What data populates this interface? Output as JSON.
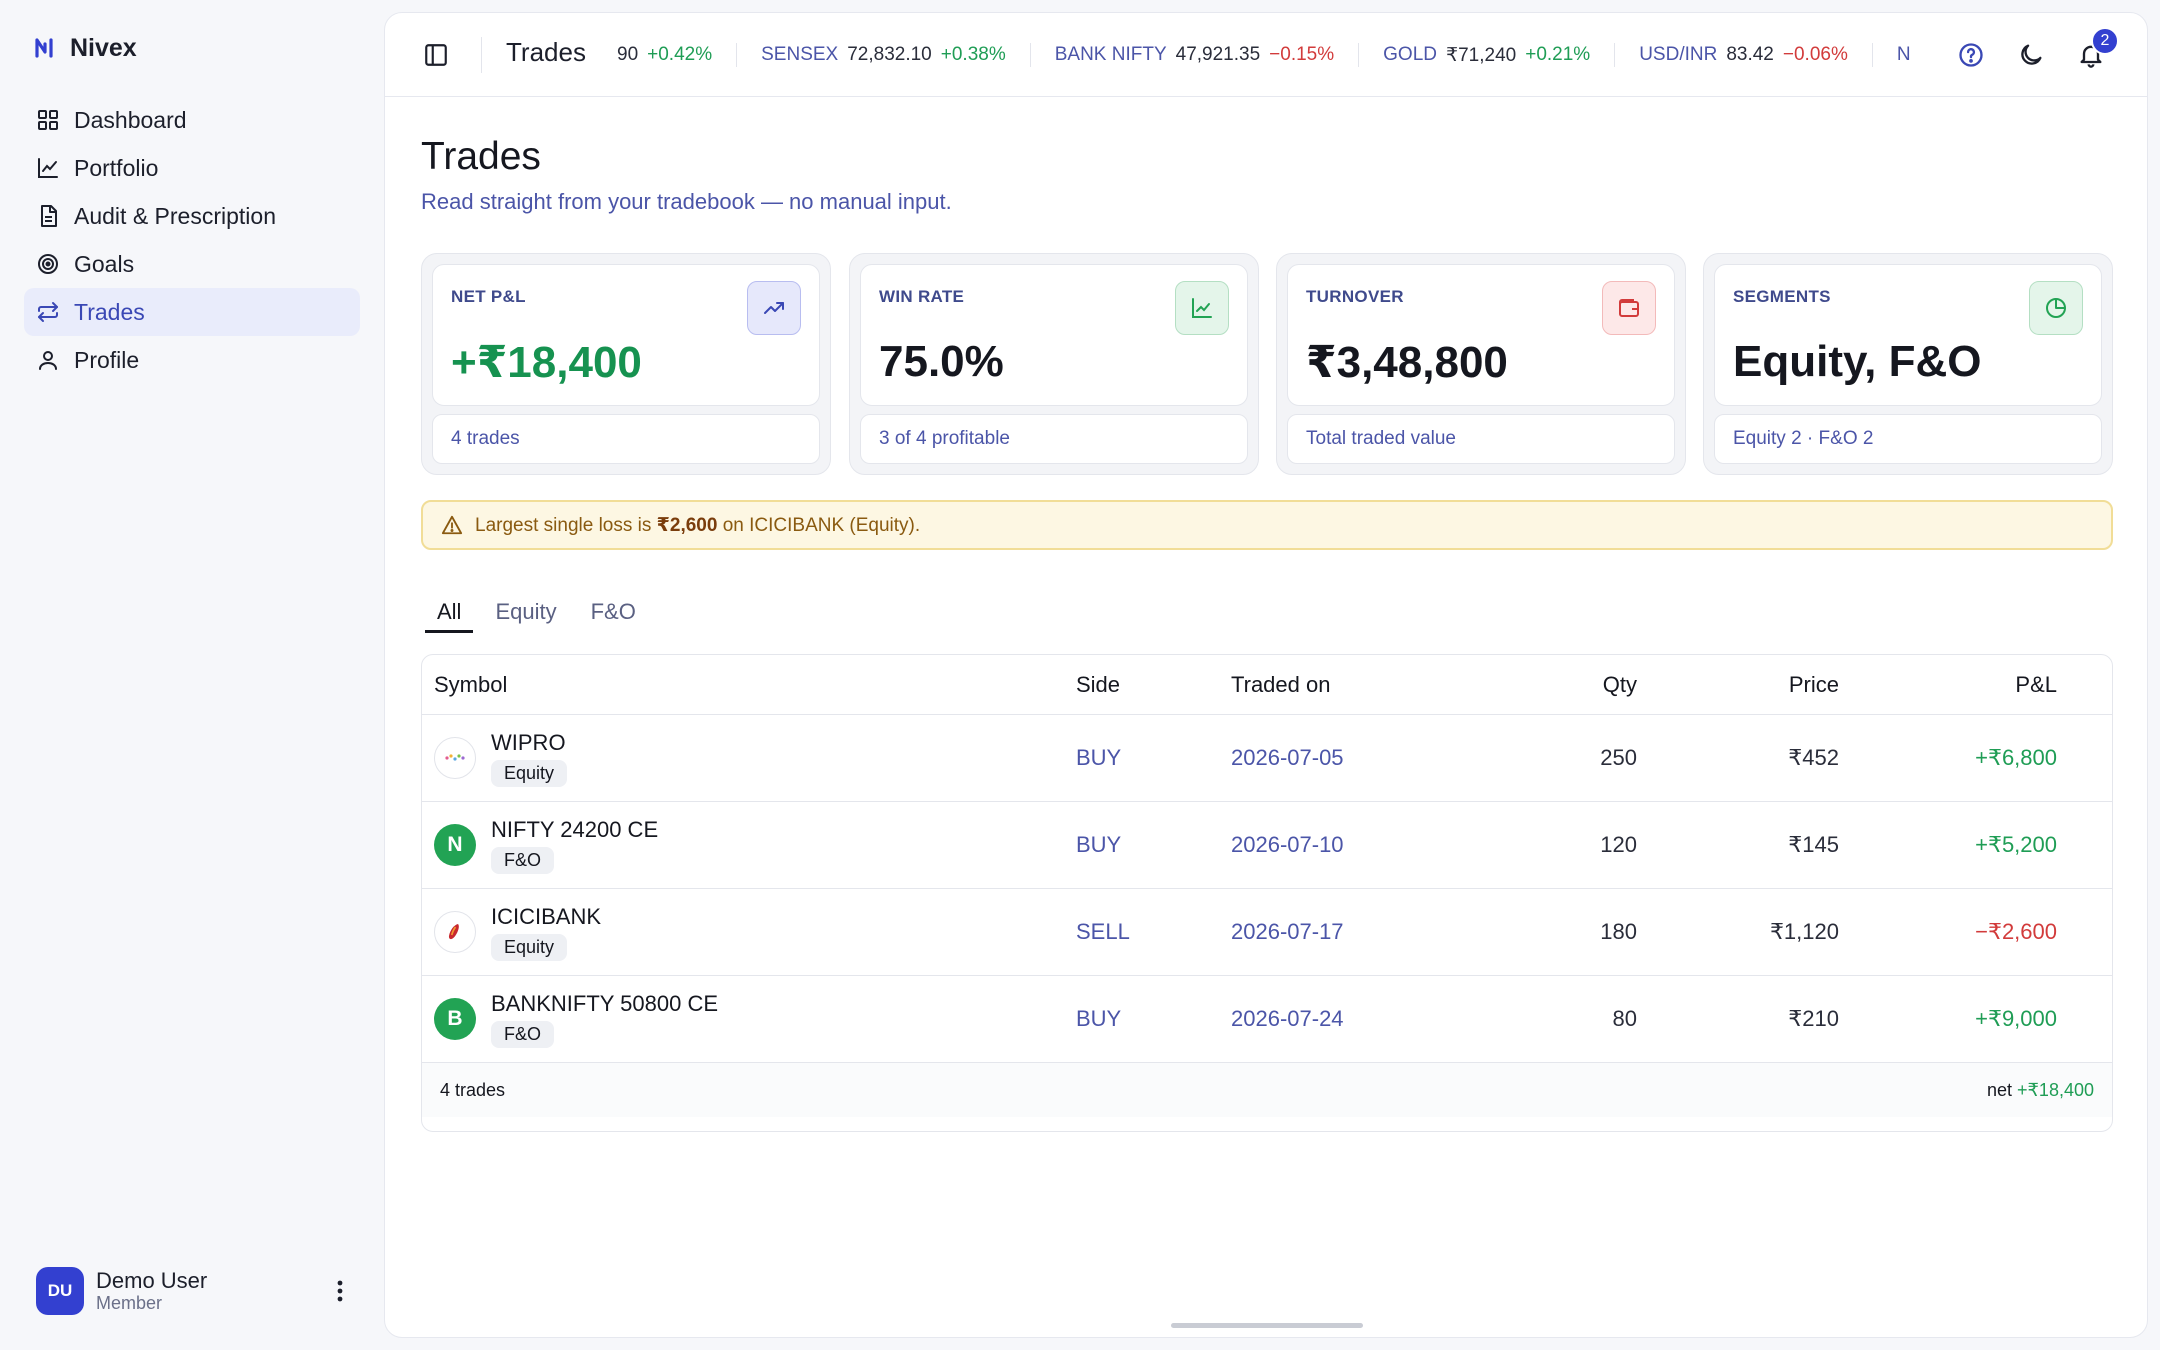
{
  "brand": {
    "name": "Nivex"
  },
  "nav": [
    {
      "label": "Dashboard",
      "icon": "dashboard-icon",
      "active": false
    },
    {
      "label": "Portfolio",
      "icon": "line-chart-icon",
      "active": false
    },
    {
      "label": "Audit & Prescription",
      "icon": "document-icon",
      "active": false
    },
    {
      "label": "Goals",
      "icon": "target-icon",
      "active": false
    },
    {
      "label": "Trades",
      "icon": "swap-icon",
      "active": true
    },
    {
      "label": "Profile",
      "icon": "user-icon",
      "active": false
    }
  ],
  "user": {
    "initials": "DU",
    "name": "Demo User",
    "role": "Member"
  },
  "topbar": {
    "title": "Trades",
    "notifications": "2",
    "ticker": [
      {
        "name": "",
        "value": "90",
        "change": "+0.42%",
        "dir": "pos"
      },
      {
        "name": "SENSEX",
        "value": "72,832.10",
        "change": "+0.38%",
        "dir": "pos"
      },
      {
        "name": "BANK NIFTY",
        "value": "47,921.35",
        "change": "−0.15%",
        "dir": "neg"
      },
      {
        "name": "GOLD",
        "value": "₹71,240",
        "change": "+0.21%",
        "dir": "pos"
      },
      {
        "name": "USD/INR",
        "value": "83.42",
        "change": "−0.06%",
        "dir": "neg"
      },
      {
        "name": "N",
        "value": "",
        "change": "",
        "dir": "pos"
      }
    ]
  },
  "page": {
    "title": "Trades",
    "subtitle": "Read straight from your tradebook — no manual input."
  },
  "stats": [
    {
      "label": "NET P&L",
      "value": "+₹18,400",
      "foot": "4 trades",
      "icon": "trend-up-icon",
      "tone": "blue",
      "green": true
    },
    {
      "label": "WIN RATE",
      "value": "75.0%",
      "foot": "3 of 4 profitable",
      "icon": "bar-chart-icon",
      "tone": "green",
      "green": false
    },
    {
      "label": "TURNOVER",
      "value": "₹3,48,800",
      "foot": "Total traded value",
      "icon": "wallet-icon",
      "tone": "red",
      "green": false
    },
    {
      "label": "SEGMENTS",
      "value": "Equity, F&O",
      "foot": "Equity 2 · F&O 2",
      "icon": "pie-chart-icon",
      "tone": "green",
      "green": false
    }
  ],
  "alert": {
    "prefix": "Largest single loss is ",
    "amount": "₹2,600",
    "suffix": " on ICICIBANK (Equity)."
  },
  "tabs": [
    {
      "label": "All",
      "active": true
    },
    {
      "label": "Equity",
      "active": false
    },
    {
      "label": "F&O",
      "active": false
    }
  ],
  "table": {
    "headers": {
      "symbol": "Symbol",
      "side": "Side",
      "date": "Traded on",
      "qty": "Qty",
      "price": "Price",
      "pl": "P&L"
    },
    "rows": [
      {
        "symbol": "WIPRO",
        "segment": "Equity",
        "logo": "wipro-logo",
        "initial": "",
        "side": "BUY",
        "date": "2026-07-05",
        "qty": "250",
        "price": "₹452",
        "pl": "+₹6,800",
        "dir": "pos"
      },
      {
        "symbol": "NIFTY 24200 CE",
        "segment": "F&O",
        "logo": "letter",
        "initial": "N",
        "side": "BUY",
        "date": "2026-07-10",
        "qty": "120",
        "price": "₹145",
        "pl": "+₹5,200",
        "dir": "pos"
      },
      {
        "symbol": "ICICIBANK",
        "segment": "Equity",
        "logo": "icici-logo",
        "initial": "",
        "side": "SELL",
        "date": "2026-07-17",
        "qty": "180",
        "price": "₹1,120",
        "pl": "−₹2,600",
        "dir": "neg"
      },
      {
        "symbol": "BANKNIFTY 50800 CE",
        "segment": "F&O",
        "logo": "letter",
        "initial": "B",
        "side": "BUY",
        "date": "2026-07-24",
        "qty": "80",
        "price": "₹210",
        "pl": "+₹9,000",
        "dir": "pos"
      }
    ],
    "footer": {
      "count": "4 trades",
      "net_label": "net ",
      "net_value": "+₹18,400"
    }
  }
}
